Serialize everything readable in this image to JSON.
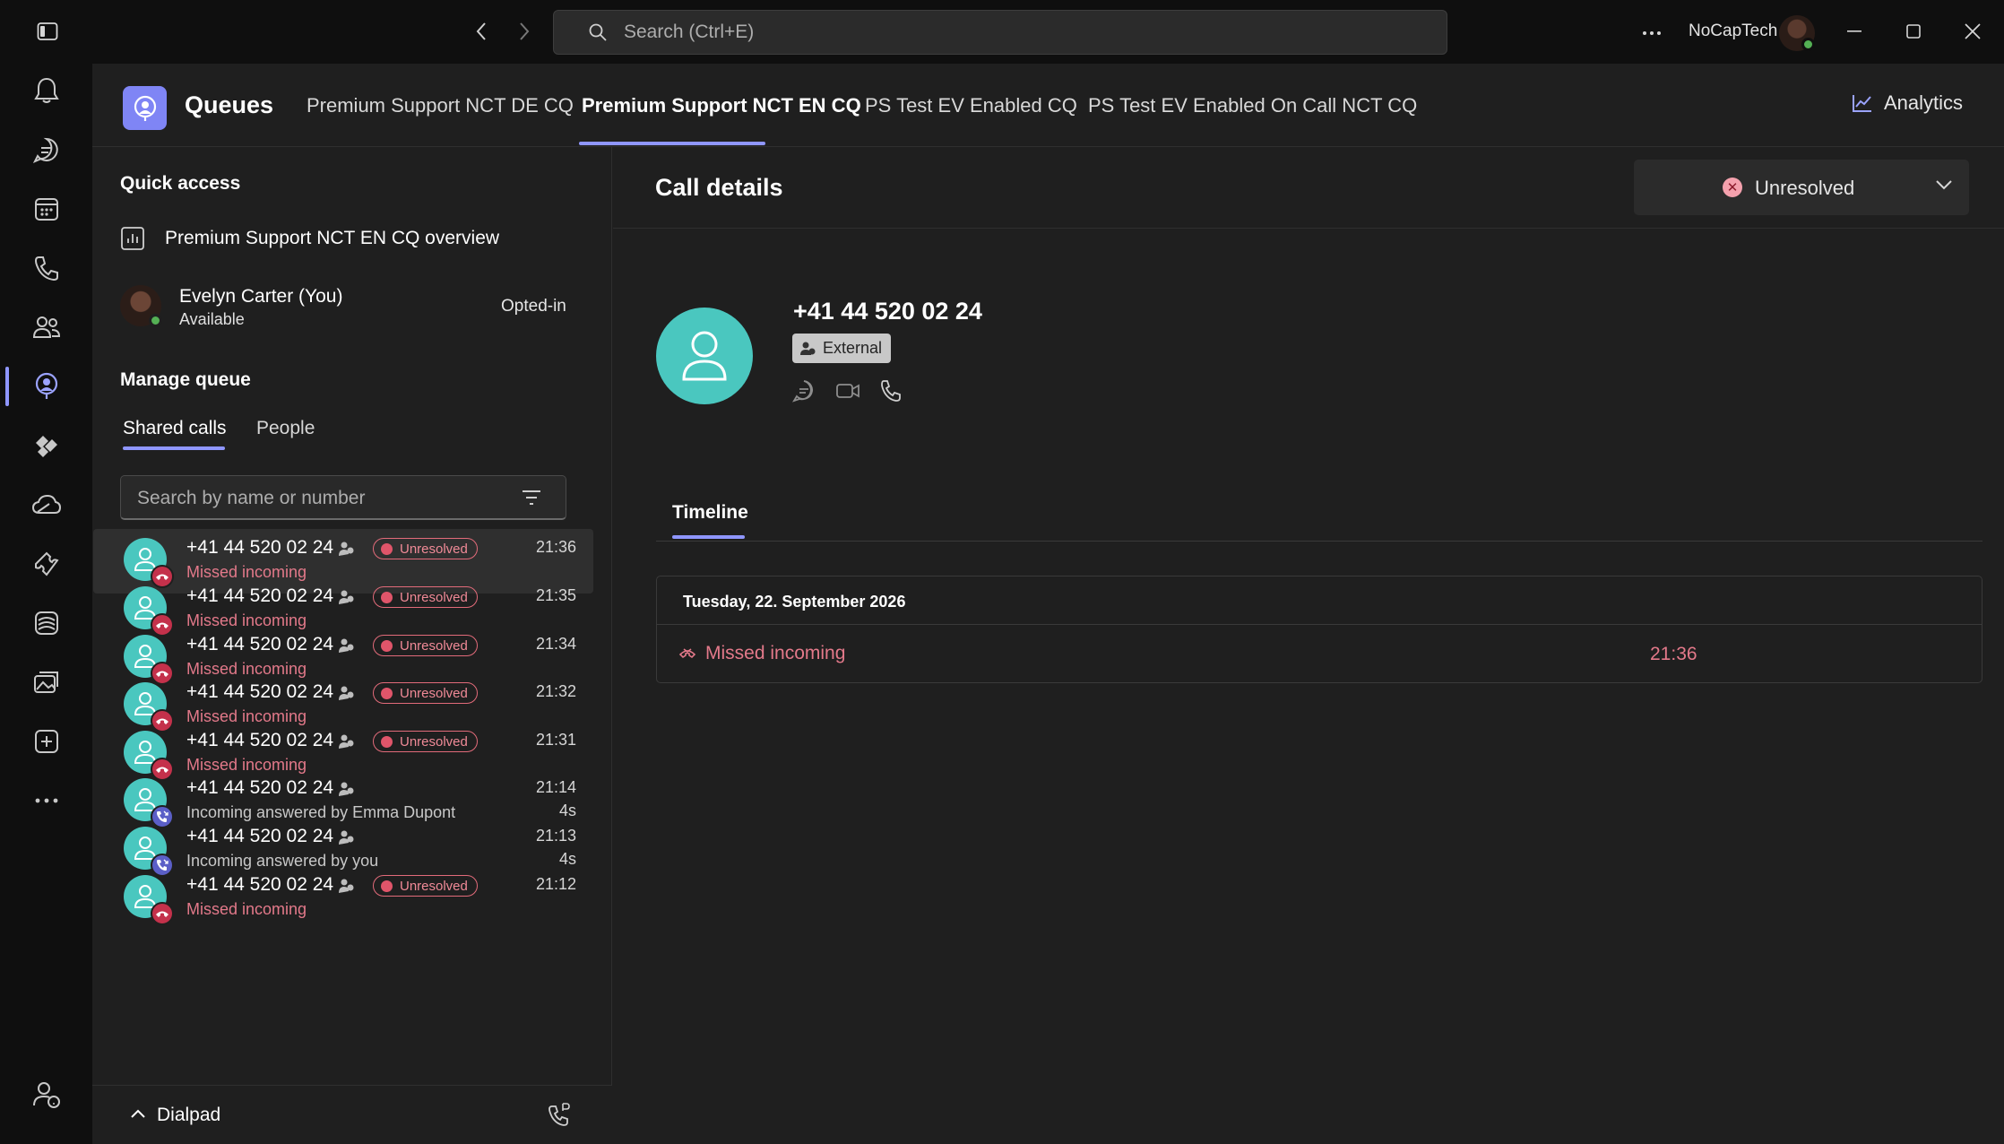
{
  "window": {
    "search_placeholder": "Search (Ctrl+E)",
    "org_name": "NoCapTech"
  },
  "rail": {
    "items": [
      "activity-icon",
      "chat-icon",
      "calendar-icon",
      "calls-icon",
      "people-icon",
      "queues-icon",
      "viva-icon",
      "onedrive-icon",
      "tickets-icon",
      "viva-learning-icon",
      "gallery-icon",
      "add-apps-icon",
      "more-icon"
    ],
    "active": "queues-icon",
    "bottom": "help-icon"
  },
  "header": {
    "app_title": "Queues",
    "tabs": [
      {
        "label": "Premium Support NCT DE CQ"
      },
      {
        "label": "Premium Support NCT EN CQ"
      },
      {
        "label": "PS Test EV Enabled CQ"
      },
      {
        "label": "PS Test EV Enabled On Call NCT CQ"
      }
    ],
    "active_tab": "Premium Support NCT EN CQ",
    "analytics_label": "Analytics"
  },
  "left": {
    "quick_access_title": "Quick access",
    "overview_label": "Premium Support NCT EN CQ overview",
    "agent": {
      "name": "Evelyn Carter (You)",
      "status": "Available",
      "opt_status": "Opted-in"
    },
    "manage_title": "Manage queue",
    "subtabs": [
      "Shared calls",
      "People"
    ],
    "search_placeholder": "Search by name or number",
    "calls": [
      {
        "number": "+41 44 520 02 24",
        "status": "Unresolved",
        "sub": "Missed incoming",
        "time": "21:36",
        "duration": "",
        "type": "missed"
      },
      {
        "number": "+41 44 520 02 24",
        "status": "Unresolved",
        "sub": "Missed incoming",
        "time": "21:35",
        "duration": "",
        "type": "missed"
      },
      {
        "number": "+41 44 520 02 24",
        "status": "Unresolved",
        "sub": "Missed incoming",
        "time": "21:34",
        "duration": "",
        "type": "missed"
      },
      {
        "number": "+41 44 520 02 24",
        "status": "Unresolved",
        "sub": "Missed incoming",
        "time": "21:32",
        "duration": "",
        "type": "missed"
      },
      {
        "number": "+41 44 520 02 24",
        "status": "Unresolved",
        "sub": "Missed incoming",
        "time": "21:31",
        "duration": "",
        "type": "missed"
      },
      {
        "number": "+41 44 520 02 24",
        "status": "",
        "sub": "Incoming answered by Emma Dupont",
        "time": "21:14",
        "duration": "4s",
        "type": "answered"
      },
      {
        "number": "+41 44 520 02 24",
        "status": "",
        "sub": "Incoming answered by you",
        "time": "21:13",
        "duration": "4s",
        "type": "answered"
      },
      {
        "number": "+41 44 520 02 24",
        "status": "Unresolved",
        "sub": "Missed incoming",
        "time": "21:12",
        "duration": "",
        "type": "missed"
      }
    ],
    "dialpad_label": "Dialpad"
  },
  "details": {
    "title": "Call details",
    "status_label": "Unresolved",
    "caller_number": "+41 44 520 02 24",
    "caller_tag": "External",
    "timeline_tab": "Timeline",
    "timeline_date": "Tuesday, 22. September 2026",
    "timeline_entry": "Missed incoming",
    "timeline_time": "21:36"
  },
  "colors": {
    "accent": "#8f96ff",
    "missed": "#e3798a",
    "avatar": "#4ac7bf"
  }
}
